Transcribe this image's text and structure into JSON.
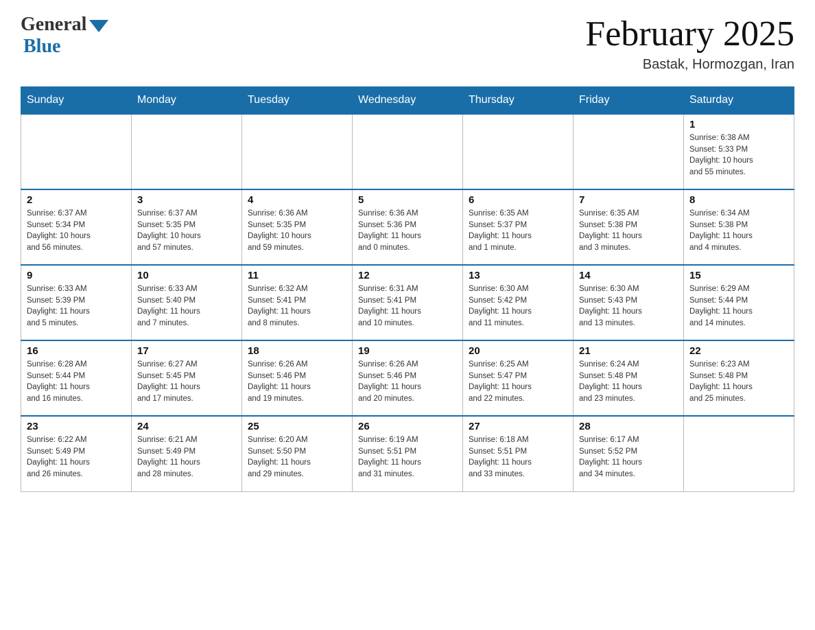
{
  "header": {
    "logo_general": "General",
    "logo_blue": "Blue",
    "month_title": "February 2025",
    "subtitle": "Bastak, Hormozgan, Iran"
  },
  "days_of_week": [
    "Sunday",
    "Monday",
    "Tuesday",
    "Wednesday",
    "Thursday",
    "Friday",
    "Saturday"
  ],
  "weeks": [
    [
      {
        "day": "",
        "info": ""
      },
      {
        "day": "",
        "info": ""
      },
      {
        "day": "",
        "info": ""
      },
      {
        "day": "",
        "info": ""
      },
      {
        "day": "",
        "info": ""
      },
      {
        "day": "",
        "info": ""
      },
      {
        "day": "1",
        "info": "Sunrise: 6:38 AM\nSunset: 5:33 PM\nDaylight: 10 hours\nand 55 minutes."
      }
    ],
    [
      {
        "day": "2",
        "info": "Sunrise: 6:37 AM\nSunset: 5:34 PM\nDaylight: 10 hours\nand 56 minutes."
      },
      {
        "day": "3",
        "info": "Sunrise: 6:37 AM\nSunset: 5:35 PM\nDaylight: 10 hours\nand 57 minutes."
      },
      {
        "day": "4",
        "info": "Sunrise: 6:36 AM\nSunset: 5:35 PM\nDaylight: 10 hours\nand 59 minutes."
      },
      {
        "day": "5",
        "info": "Sunrise: 6:36 AM\nSunset: 5:36 PM\nDaylight: 11 hours\nand 0 minutes."
      },
      {
        "day": "6",
        "info": "Sunrise: 6:35 AM\nSunset: 5:37 PM\nDaylight: 11 hours\nand 1 minute."
      },
      {
        "day": "7",
        "info": "Sunrise: 6:35 AM\nSunset: 5:38 PM\nDaylight: 11 hours\nand 3 minutes."
      },
      {
        "day": "8",
        "info": "Sunrise: 6:34 AM\nSunset: 5:38 PM\nDaylight: 11 hours\nand 4 minutes."
      }
    ],
    [
      {
        "day": "9",
        "info": "Sunrise: 6:33 AM\nSunset: 5:39 PM\nDaylight: 11 hours\nand 5 minutes."
      },
      {
        "day": "10",
        "info": "Sunrise: 6:33 AM\nSunset: 5:40 PM\nDaylight: 11 hours\nand 7 minutes."
      },
      {
        "day": "11",
        "info": "Sunrise: 6:32 AM\nSunset: 5:41 PM\nDaylight: 11 hours\nand 8 minutes."
      },
      {
        "day": "12",
        "info": "Sunrise: 6:31 AM\nSunset: 5:41 PM\nDaylight: 11 hours\nand 10 minutes."
      },
      {
        "day": "13",
        "info": "Sunrise: 6:30 AM\nSunset: 5:42 PM\nDaylight: 11 hours\nand 11 minutes."
      },
      {
        "day": "14",
        "info": "Sunrise: 6:30 AM\nSunset: 5:43 PM\nDaylight: 11 hours\nand 13 minutes."
      },
      {
        "day": "15",
        "info": "Sunrise: 6:29 AM\nSunset: 5:44 PM\nDaylight: 11 hours\nand 14 minutes."
      }
    ],
    [
      {
        "day": "16",
        "info": "Sunrise: 6:28 AM\nSunset: 5:44 PM\nDaylight: 11 hours\nand 16 minutes."
      },
      {
        "day": "17",
        "info": "Sunrise: 6:27 AM\nSunset: 5:45 PM\nDaylight: 11 hours\nand 17 minutes."
      },
      {
        "day": "18",
        "info": "Sunrise: 6:26 AM\nSunset: 5:46 PM\nDaylight: 11 hours\nand 19 minutes."
      },
      {
        "day": "19",
        "info": "Sunrise: 6:26 AM\nSunset: 5:46 PM\nDaylight: 11 hours\nand 20 minutes."
      },
      {
        "day": "20",
        "info": "Sunrise: 6:25 AM\nSunset: 5:47 PM\nDaylight: 11 hours\nand 22 minutes."
      },
      {
        "day": "21",
        "info": "Sunrise: 6:24 AM\nSunset: 5:48 PM\nDaylight: 11 hours\nand 23 minutes."
      },
      {
        "day": "22",
        "info": "Sunrise: 6:23 AM\nSunset: 5:48 PM\nDaylight: 11 hours\nand 25 minutes."
      }
    ],
    [
      {
        "day": "23",
        "info": "Sunrise: 6:22 AM\nSunset: 5:49 PM\nDaylight: 11 hours\nand 26 minutes."
      },
      {
        "day": "24",
        "info": "Sunrise: 6:21 AM\nSunset: 5:49 PM\nDaylight: 11 hours\nand 28 minutes."
      },
      {
        "day": "25",
        "info": "Sunrise: 6:20 AM\nSunset: 5:50 PM\nDaylight: 11 hours\nand 29 minutes."
      },
      {
        "day": "26",
        "info": "Sunrise: 6:19 AM\nSunset: 5:51 PM\nDaylight: 11 hours\nand 31 minutes."
      },
      {
        "day": "27",
        "info": "Sunrise: 6:18 AM\nSunset: 5:51 PM\nDaylight: 11 hours\nand 33 minutes."
      },
      {
        "day": "28",
        "info": "Sunrise: 6:17 AM\nSunset: 5:52 PM\nDaylight: 11 hours\nand 34 minutes."
      },
      {
        "day": "",
        "info": ""
      }
    ]
  ]
}
